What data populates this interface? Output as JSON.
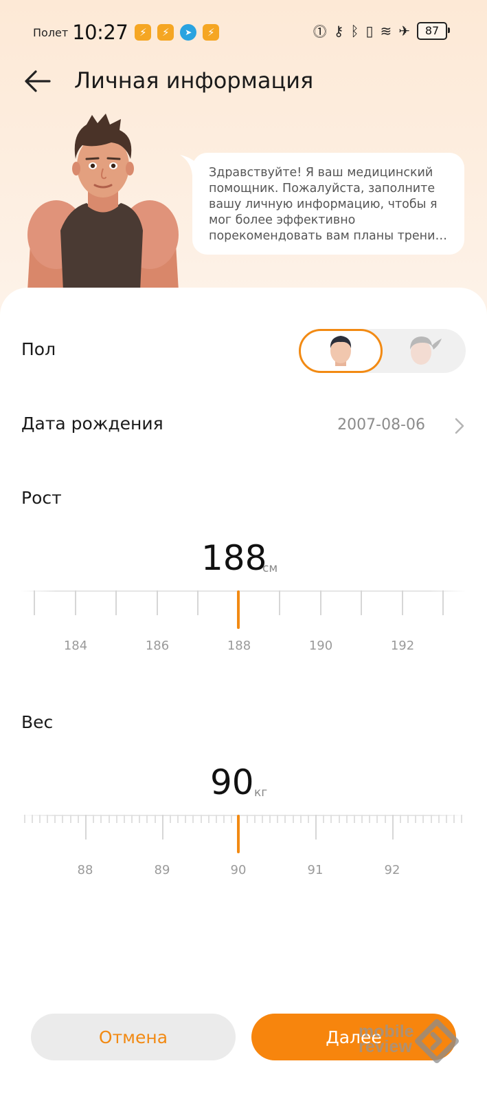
{
  "status_bar": {
    "mode": "Полет",
    "time": "10:27",
    "notifications": [
      "run-app-icon",
      "run-app-icon",
      "telegram-icon",
      "run-app-icon"
    ],
    "battery": "87"
  },
  "header": {
    "title": "Личная информация"
  },
  "assistant": {
    "message": "Здравствуйте! Я ваш медицинский помощник. Пожалуйста, заполните вашу личную информацию, чтобы я мог более эффективно порекомендовать вам планы трени…"
  },
  "form": {
    "gender_label": "Пол",
    "gender_selected": "male",
    "birth_label": "Дата рождения",
    "birth_value": "2007-08-06",
    "height_label": "Рост",
    "height_value": "188",
    "height_unit": "см",
    "height_ticks": [
      "184",
      "186",
      "188",
      "190",
      "192"
    ],
    "weight_label": "Вес",
    "weight_value": "90",
    "weight_unit": "кг",
    "weight_ticks": [
      "88",
      "89",
      "90",
      "91",
      "92"
    ]
  },
  "buttons": {
    "cancel": "Отмена",
    "next": "Далее"
  },
  "watermark": {
    "line1": "mobile",
    "line2": "review"
  },
  "colors": {
    "accent": "#f28a13",
    "next_button": "#f7850d",
    "cancel_button": "#ebebeb"
  }
}
